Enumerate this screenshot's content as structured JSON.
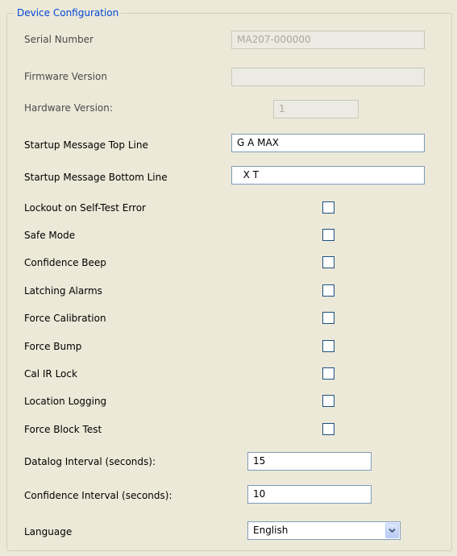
{
  "group": {
    "title": "Device Configuration"
  },
  "fields": {
    "serial_number": {
      "label": "Serial Number",
      "value": "MA207-000000"
    },
    "firmware_version": {
      "label": "Firmware Version",
      "value": ""
    },
    "hardware_version": {
      "label": "Hardware Version:",
      "value": "1"
    },
    "startup_top": {
      "label": "Startup Message Top Line",
      "value": "G A MAX"
    },
    "startup_bottom": {
      "label": "Startup Message Bottom Line",
      "value": "  X T"
    }
  },
  "checkboxes": [
    {
      "label": "Lockout on Self-Test Error",
      "checked": false
    },
    {
      "label": "Safe Mode",
      "checked": false
    },
    {
      "label": "Confidence Beep",
      "checked": false
    },
    {
      "label": "Latching Alarms",
      "checked": false
    },
    {
      "label": "Force Calibration",
      "checked": false
    },
    {
      "label": "Force Bump",
      "checked": false
    },
    {
      "label": "Cal IR Lock",
      "checked": false
    },
    {
      "label": "Location Logging",
      "checked": false
    },
    {
      "label": "Force Block Test",
      "checked": false
    }
  ],
  "intervals": {
    "datalog": {
      "label": "Datalog Interval (seconds):",
      "value": "15"
    },
    "confidence": {
      "label": "Confidence Interval (seconds):",
      "value": "10"
    }
  },
  "language": {
    "label": "Language",
    "value": "English",
    "icon": "chevron-down-icon"
  },
  "colors": {
    "group_title": "#0046d5",
    "field_border": "#7f9db9",
    "background": "#ece9d8"
  }
}
